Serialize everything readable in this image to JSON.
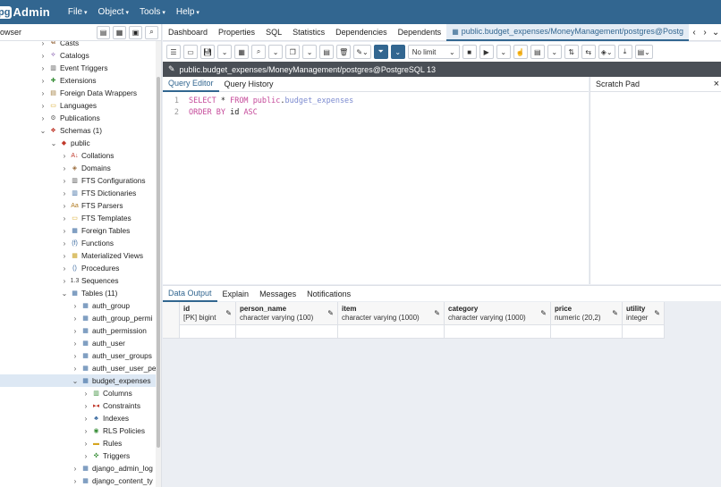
{
  "app": {
    "logo_pg": "pg",
    "logo_admin": "Admin"
  },
  "menu": [
    {
      "label": "File"
    },
    {
      "label": "Object"
    },
    {
      "label": "Tools"
    },
    {
      "label": "Help"
    }
  ],
  "browser": {
    "title": "rowser"
  },
  "tree": [
    {
      "label": "Casts",
      "indent": 0,
      "toggle": "›",
      "icon": "cast-icon"
    },
    {
      "label": "Catalogs",
      "indent": 0,
      "toggle": "›",
      "icon": "catalog-icon"
    },
    {
      "label": "Event Triggers",
      "indent": 0,
      "toggle": "›",
      "icon": "event-trigger-icon"
    },
    {
      "label": "Extensions",
      "indent": 0,
      "toggle": "›",
      "icon": "extension-icon"
    },
    {
      "label": "Foreign Data Wrappers",
      "indent": 0,
      "toggle": "›",
      "icon": "fdw-icon"
    },
    {
      "label": "Languages",
      "indent": 0,
      "toggle": "›",
      "icon": "language-icon"
    },
    {
      "label": "Publications",
      "indent": 0,
      "toggle": "›",
      "icon": "publication-icon"
    },
    {
      "label": "Schemas (1)",
      "indent": 0,
      "toggle": "⌄",
      "icon": "schema-icon"
    },
    {
      "label": "public",
      "indent": 1,
      "toggle": "⌄",
      "icon": "schema-public-icon"
    },
    {
      "label": "Collations",
      "indent": 2,
      "toggle": "›",
      "icon": "collation-icon"
    },
    {
      "label": "Domains",
      "indent": 2,
      "toggle": "›",
      "icon": "domain-icon"
    },
    {
      "label": "FTS Configurations",
      "indent": 2,
      "toggle": "›",
      "icon": "fts-config-icon"
    },
    {
      "label": "FTS Dictionaries",
      "indent": 2,
      "toggle": "›",
      "icon": "fts-dictionary-icon"
    },
    {
      "label": "FTS Parsers",
      "indent": 2,
      "toggle": "›",
      "icon": "fts-parser-icon"
    },
    {
      "label": "FTS Templates",
      "indent": 2,
      "toggle": "›",
      "icon": "fts-template-icon"
    },
    {
      "label": "Foreign Tables",
      "indent": 2,
      "toggle": "›",
      "icon": "foreign-table-icon"
    },
    {
      "label": "Functions",
      "indent": 2,
      "toggle": "›",
      "icon": "function-icon"
    },
    {
      "label": "Materialized Views",
      "indent": 2,
      "toggle": "›",
      "icon": "mview-icon"
    },
    {
      "label": "Procedures",
      "indent": 2,
      "toggle": "›",
      "icon": "procedure-icon"
    },
    {
      "label": "Sequences",
      "indent": 2,
      "toggle": "›",
      "icon": "sequence-icon"
    },
    {
      "label": "Tables (11)",
      "indent": 2,
      "toggle": "⌄",
      "icon": "tables-icon"
    },
    {
      "label": "auth_group",
      "indent": 3,
      "toggle": "›",
      "icon": "table-icon"
    },
    {
      "label": "auth_group_permi",
      "indent": 3,
      "toggle": "›",
      "icon": "table-icon"
    },
    {
      "label": "auth_permission",
      "indent": 3,
      "toggle": "›",
      "icon": "table-icon"
    },
    {
      "label": "auth_user",
      "indent": 3,
      "toggle": "›",
      "icon": "table-icon"
    },
    {
      "label": "auth_user_groups",
      "indent": 3,
      "toggle": "›",
      "icon": "table-icon"
    },
    {
      "label": "auth_user_user_pe",
      "indent": 3,
      "toggle": "›",
      "icon": "table-icon"
    },
    {
      "label": "budget_expenses",
      "indent": 3,
      "toggle": "⌄",
      "icon": "table-icon",
      "selected": true
    },
    {
      "label": "Columns",
      "indent": 4,
      "toggle": "›",
      "icon": "columns-icon"
    },
    {
      "label": "Constraints",
      "indent": 4,
      "toggle": "›",
      "icon": "constraints-icon"
    },
    {
      "label": "Indexes",
      "indent": 4,
      "toggle": "›",
      "icon": "indexes-icon"
    },
    {
      "label": "RLS Policies",
      "indent": 4,
      "toggle": "›",
      "icon": "rls-policy-icon"
    },
    {
      "label": "Rules",
      "indent": 4,
      "toggle": "›",
      "icon": "rules-icon"
    },
    {
      "label": "Triggers",
      "indent": 4,
      "toggle": "›",
      "icon": "triggers-icon"
    },
    {
      "label": "django_admin_log",
      "indent": 3,
      "toggle": "›",
      "icon": "table-icon"
    },
    {
      "label": "django_content_ty",
      "indent": 3,
      "toggle": "›",
      "icon": "table-icon"
    }
  ],
  "tabs": [
    {
      "label": "Dashboard"
    },
    {
      "label": "Properties"
    },
    {
      "label": "SQL"
    },
    {
      "label": "Statistics"
    },
    {
      "label": "Dependencies"
    },
    {
      "label": "Dependents"
    }
  ],
  "active_tab": {
    "label": "public.budget_expenses/MoneyManagement/postgres@Postg"
  },
  "toolbar": {
    "limit": "No limit"
  },
  "connection": {
    "label": "public.budget_expenses/MoneyManagement/postgres@PostgreSQL 13"
  },
  "editor_tabs": [
    {
      "label": "Query Editor"
    },
    {
      "label": "Query History"
    }
  ],
  "scratch_pad": {
    "label": "Scratch Pad",
    "close": "×"
  },
  "editor": {
    "lines": [
      {
        "num": "1",
        "parts": [
          {
            "t": "SELECT",
            "c": "kw"
          },
          {
            "t": " * "
          },
          {
            "t": "FROM",
            "c": "kw"
          },
          {
            "t": " "
          },
          {
            "t": "public",
            "c": "kw"
          },
          {
            "t": "."
          },
          {
            "t": "budget_expenses",
            "c": "tbl"
          }
        ]
      },
      {
        "num": "2",
        "parts": [
          {
            "t": "ORDER BY",
            "c": "kw"
          },
          {
            "t": " id "
          },
          {
            "t": "ASC",
            "c": "kw"
          }
        ]
      }
    ]
  },
  "output_tabs": [
    {
      "label": "Data Output"
    },
    {
      "label": "Explain"
    },
    {
      "label": "Messages"
    },
    {
      "label": "Notifications"
    }
  ],
  "columns": [
    {
      "name": "id",
      "type": "[PK] bigint"
    },
    {
      "name": "person_name",
      "type": "character varying (100)"
    },
    {
      "name": "item",
      "type": "character varying (1000)"
    },
    {
      "name": "category",
      "type": "character varying (1000)"
    },
    {
      "name": "price",
      "type": "numeric (20,2)"
    },
    {
      "name": "utility",
      "type": "integer"
    }
  ]
}
